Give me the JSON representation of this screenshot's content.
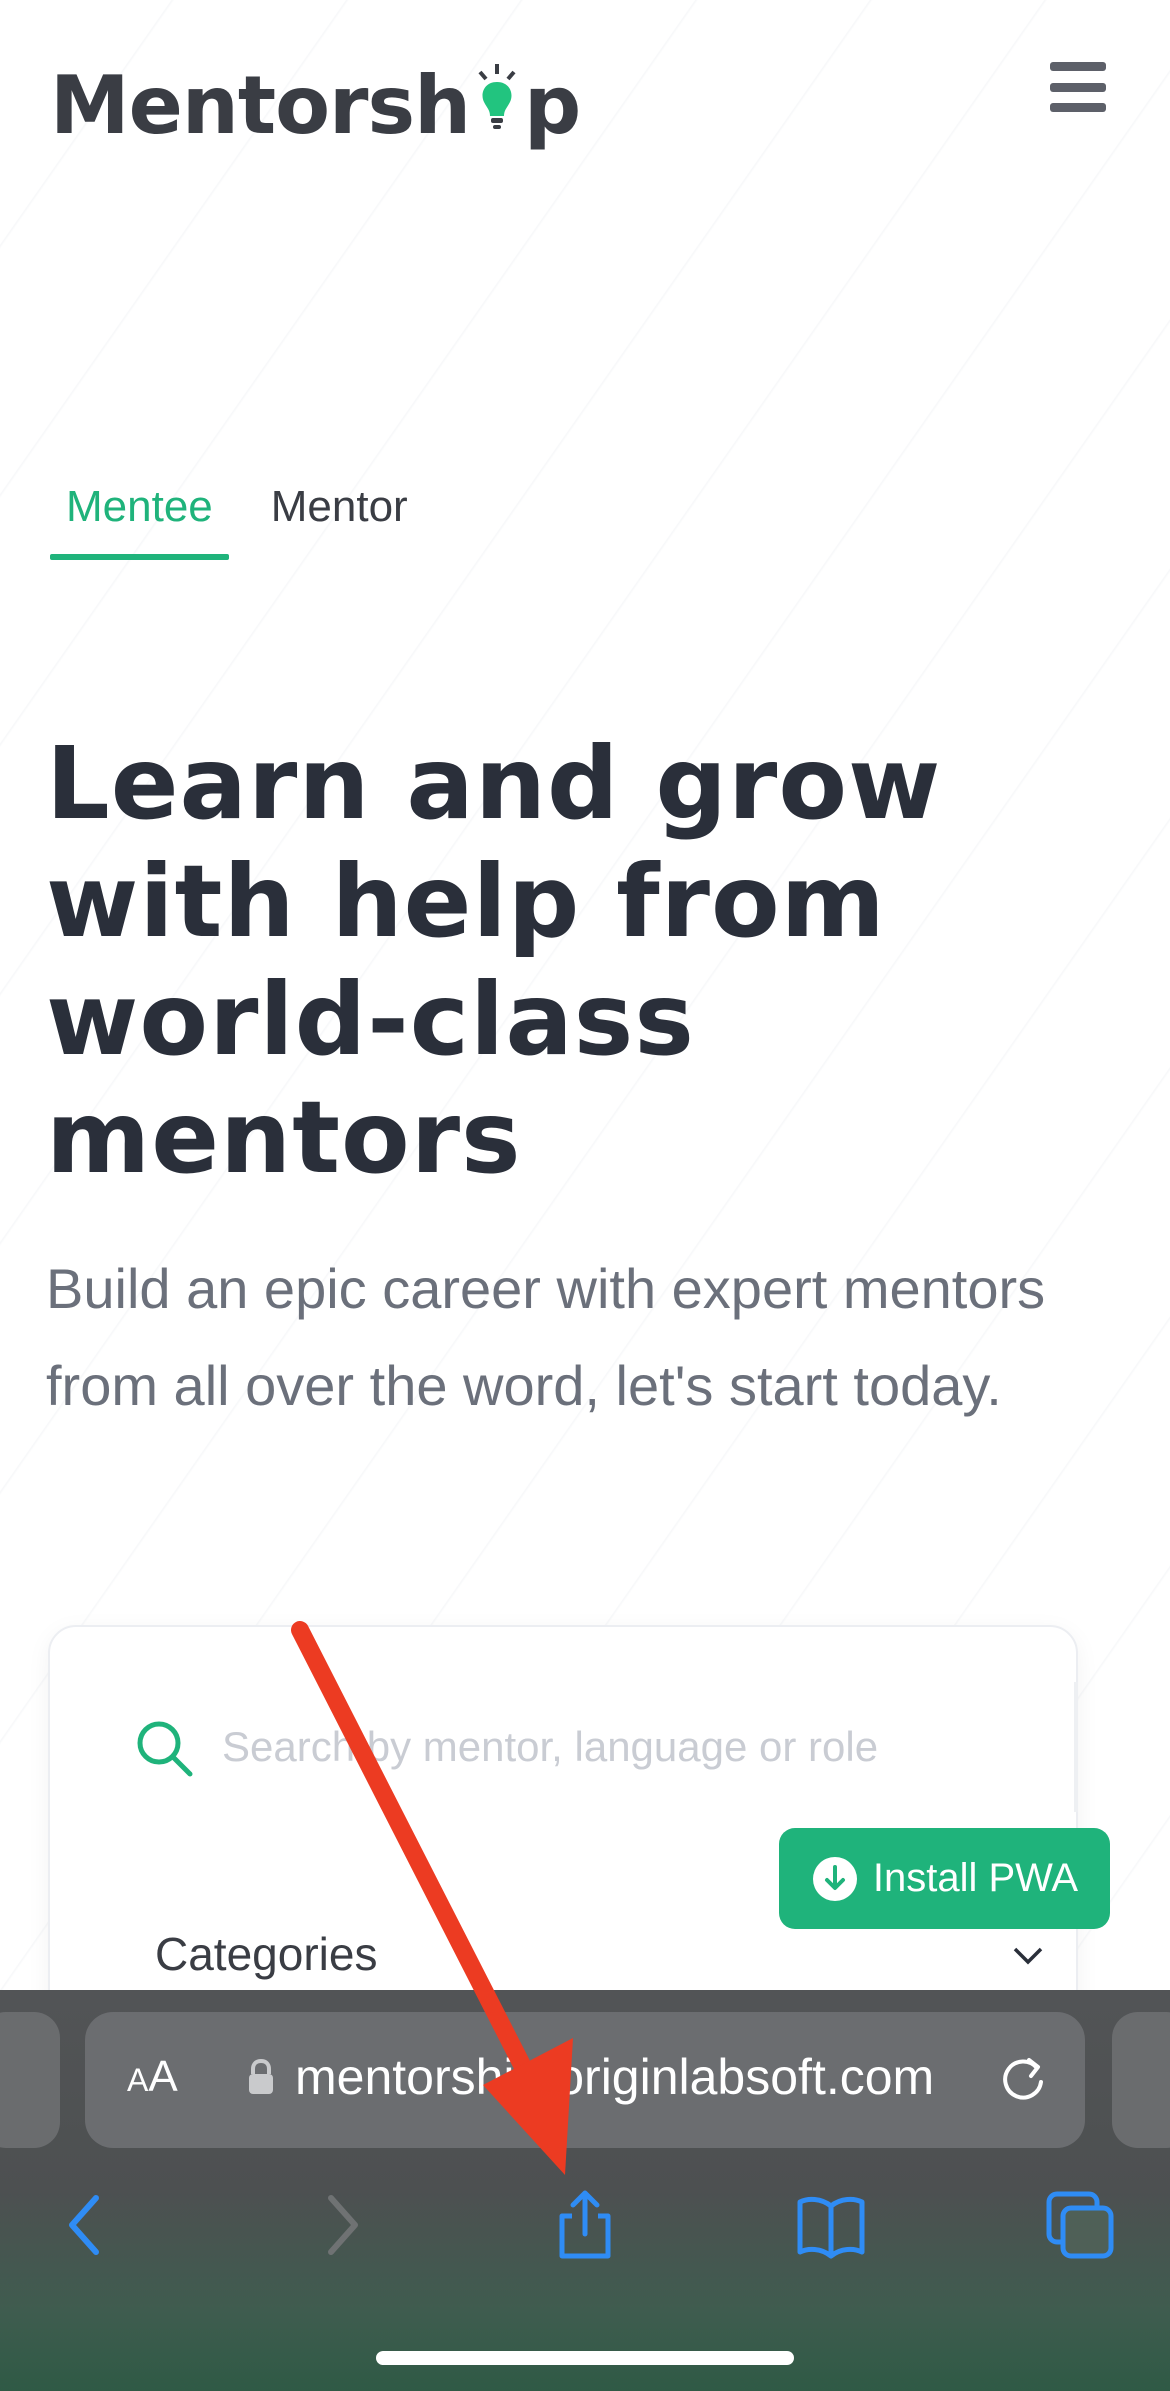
{
  "header": {
    "logo_text_start": "Mentorsh",
    "logo_text_end": "p",
    "menu_icon": "hamburger-icon"
  },
  "tabs": [
    {
      "label": "Mentee",
      "active": true
    },
    {
      "label": "Mentor",
      "active": false
    }
  ],
  "hero": {
    "title": "Learn and grow with help from world-class mentors",
    "subtitle": "Build an epic career with expert mentors from all over the word, let's start today."
  },
  "search": {
    "placeholder": "Search by mentor, language or role",
    "icon": "search-icon"
  },
  "filters": {
    "categories_label": "Categories"
  },
  "pwa": {
    "label": "Install PWA",
    "icon": "download-icon"
  },
  "browser": {
    "aa_small": "A",
    "aa_large": "A",
    "url": "mentorship.originlabsoft.com",
    "toolbar_icons": [
      "back-icon",
      "forward-icon",
      "share-icon",
      "bookmarks-icon",
      "tabs-icon"
    ]
  },
  "colors": {
    "accent": "#1fb37b",
    "heading": "#2a2f3a",
    "subtext": "#6b707b",
    "ios_blue": "#2f8cf5",
    "annotation_red": "#ec3b22"
  }
}
